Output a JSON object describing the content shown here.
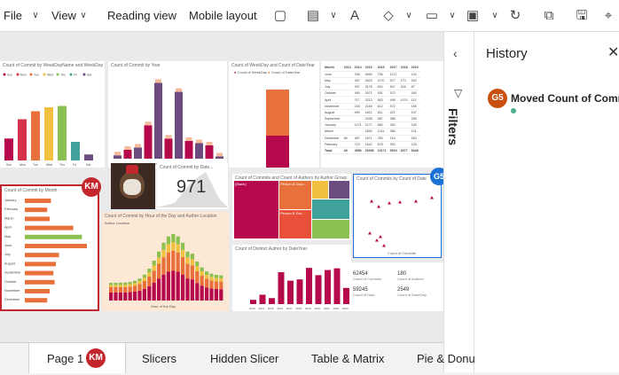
{
  "menu": {
    "file": "File",
    "view": "View",
    "reading_view": "Reading view",
    "mobile_layout": "Mobile layout"
  },
  "history": {
    "title": "History",
    "entry_badge": "G5",
    "entry_text": "Moved Count of Comm"
  },
  "filters_label": "Filters",
  "tabs": {
    "page1": "Page 1",
    "page1_badge": "KM",
    "slicers": "Slicers",
    "hidden_slicer": "Hidden Slicer",
    "table_matrix": "Table & Matrix",
    "pie_donut": "Pie & Donu"
  },
  "colors": {
    "accent": "#b5094c",
    "warm_orange": "#e8703a",
    "yellow": "#f0c040",
    "green": "#8cc152",
    "teal": "#41a29c",
    "purple": "#6c4b7e",
    "badge_red": "#c4262e",
    "badge_orange": "#ca5010",
    "selection_blue": "#1a73d4"
  },
  "visuals": {
    "v1_title": "Count of Commit by WeekDayName and WeekDay",
    "v1_legend": [
      "Sun",
      "Mon",
      "Tue",
      "Wed",
      "Thu",
      "Fri",
      "Sat"
    ],
    "v2_title": "Count of Commit by Year",
    "v3_title": "Count of WeekDay and Count of DateYear",
    "v3_legend": [
      "Count of WeekDay",
      "Count of DateYear"
    ],
    "v4_head": [
      "Month",
      "2013",
      "2014",
      "2015",
      "2016",
      "2017",
      "2018",
      "2019"
    ],
    "v4_rows": [
      [
        "June",
        "",
        "246",
        "4694",
        "736",
        "1172",
        "",
        "124"
      ],
      [
        "May",
        "",
        "287",
        "2623",
        "1170",
        "577",
        "173",
        "152"
      ],
      [
        "July",
        "",
        "397",
        "3178",
        "824",
        "547",
        "415",
        "67"
      ],
      [
        "October",
        "",
        "490",
        "2671",
        "451",
        "572",
        "",
        "160"
      ],
      [
        "April",
        "",
        "717",
        "3213",
        "963",
        "498",
        "1074",
        "113"
      ],
      [
        "November",
        "",
        "218",
        "2163",
        "612",
        "572",
        "",
        "155"
      ],
      [
        "August",
        "",
        "499",
        "1812",
        "811",
        "422",
        "",
        "197"
      ],
      [
        "September",
        "",
        "",
        "2438",
        "587",
        "388",
        "",
        "189"
      ],
      [
        "January",
        "",
        "1174",
        "2177",
        "684",
        "352",
        "",
        "145"
      ],
      [
        "March",
        "",
        "",
        "1830",
        "1011",
        "386",
        "",
        "131"
      ],
      [
        "December",
        "56",
        "487",
        "1671",
        "780",
        "219",
        "",
        "160"
      ],
      [
        "February",
        "",
        "719",
        "1642",
        "678",
        "393",
        "",
        "133"
      ],
      [
        "Total",
        "49",
        "4556",
        "26935",
        "10171",
        "9519",
        "6077",
        "5448"
      ]
    ],
    "v5_title": "Count of Commit by Month",
    "v5_badge": "KM",
    "v5_rows": [
      "January",
      "February",
      "March",
      "April",
      "May",
      "June",
      "July",
      "August",
      "September",
      "October",
      "November",
      "December"
    ],
    "v6_kpi_label": "Count of Commit by Date...",
    "v6_kpi": "971",
    "v7_title": "Count of Commit by Hour of the Day and Author Location",
    "v7_legend_label": "Author Location",
    "v7_xlabel": "Hour of the Day",
    "v8_title": "Count of Commits and Count of Authors by Author Group",
    "v8_cells": [
      "(Blank)",
      "Person B Grou...",
      "Person B Gro..."
    ],
    "v9_title": "Count of Commits by Count of Date",
    "v9_badge": "G5",
    "v9_xlabel": "Count of Commits",
    "v9_ylabel": "Count of Date",
    "v10_title": "Count of Distinct Author by DateYear",
    "v10_cats": [
      "2013",
      "2014",
      "2015",
      "2016",
      "2017",
      "2018",
      "2019",
      "2020",
      "2021",
      "2022",
      "2023"
    ],
    "v11": [
      {
        "value": "62454",
        "label": "Count of Commits"
      },
      {
        "value": "180",
        "label": "Count of Authors"
      },
      {
        "value": "59245",
        "label": "Count of Date"
      },
      {
        "value": "2549",
        "label": "Count of DateOnly"
      }
    ]
  },
  "chart_data": [
    {
      "type": "bar",
      "title": "Count of Commit by WeekDayName and WeekDay",
      "categories": [
        "Sun",
        "Mon",
        "Tue",
        "Wed",
        "Thu",
        "Fri",
        "Sat"
      ],
      "values": [
        33,
        62,
        74,
        80,
        82,
        28,
        9
      ]
    },
    {
      "type": "bar",
      "title": "Count of Commit by Year",
      "categories": [
        "2013",
        "2014",
        "2015",
        "2016",
        "2017",
        "2018",
        "2019",
        "2020",
        "2021",
        "2022",
        "2023"
      ],
      "values": [
        3,
        8,
        10,
        30,
        68,
        18,
        60,
        16,
        14,
        12,
        2
      ]
    },
    {
      "type": "bar",
      "title": "Count of Distinct Author by DateYear",
      "categories": [
        "2013",
        "2014",
        "2015",
        "2016",
        "2017",
        "2018",
        "2019",
        "2020",
        "2021",
        "2022",
        "2023"
      ],
      "values": [
        10,
        22,
        14,
        75,
        55,
        58,
        85,
        68,
        80,
        84,
        38
      ]
    },
    {
      "type": "bar",
      "title": "Count of Commit by Month",
      "categories": [
        "January",
        "February",
        "March",
        "April",
        "May",
        "June",
        "July",
        "August",
        "September",
        "October",
        "November",
        "December"
      ],
      "values": [
        42,
        36,
        40,
        78,
        92,
        100,
        55,
        50,
        46,
        48,
        40,
        36
      ]
    }
  ]
}
